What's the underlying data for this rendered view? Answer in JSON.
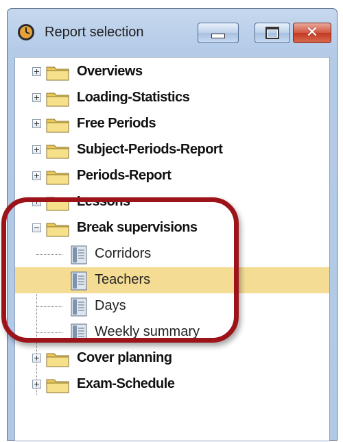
{
  "window": {
    "title": "Report selection",
    "icon": "clock-icon",
    "controls": [
      "minimize-icon",
      "maximize-icon",
      "close-icon"
    ]
  },
  "tree": {
    "items": [
      {
        "label": "Overviews",
        "type": "folder",
        "expander": "plus"
      },
      {
        "label": "Loading-Statistics",
        "type": "folder",
        "expander": "plus"
      },
      {
        "label": "Free Periods",
        "type": "folder",
        "expander": "plus"
      },
      {
        "label": "Subject-Periods-Report",
        "type": "folder",
        "expander": "plus"
      },
      {
        "label": "Periods-Report",
        "type": "folder",
        "expander": "plus"
      },
      {
        "label": "Lessons",
        "type": "folder",
        "expander": "plus"
      },
      {
        "label": "Break supervisions",
        "type": "folder",
        "expander": "minus"
      },
      {
        "label": "Corridors",
        "type": "report"
      },
      {
        "label": "Teachers",
        "type": "report",
        "selected": true
      },
      {
        "label": "Days",
        "type": "report"
      },
      {
        "label": "Weekly summary",
        "type": "report"
      },
      {
        "label": "Cover planning",
        "type": "folder",
        "expander": "plus"
      },
      {
        "label": "Exam-Schedule",
        "type": "folder",
        "expander": "plus"
      }
    ]
  },
  "colors": {
    "selection": "#f5dc94",
    "highlight_outline": "#9c1419",
    "folder_fill": "#f7e08a"
  }
}
